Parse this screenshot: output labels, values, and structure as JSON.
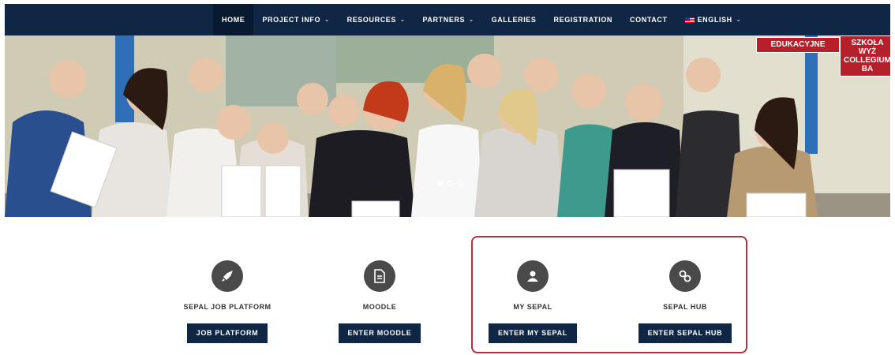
{
  "nav": {
    "items": [
      {
        "label": "HOME",
        "dropdown": false,
        "active": true
      },
      {
        "label": "PROJECT INFO",
        "dropdown": true
      },
      {
        "label": "RESOURCES",
        "dropdown": true
      },
      {
        "label": "PARTNERS",
        "dropdown": true
      },
      {
        "label": "GALLERIES",
        "dropdown": false
      },
      {
        "label": "REGISTRATION",
        "dropdown": false
      },
      {
        "label": "CONTACT",
        "dropdown": false
      },
      {
        "label": "ENGLISH",
        "dropdown": true,
        "icon": "uk-flag-icon"
      }
    ]
  },
  "hero": {
    "signs": [
      "EDUKACYJNE",
      "SZKOŁA WYŻ",
      "COLLEGIUM BA"
    ],
    "slider_dots": 3,
    "active_dot": 0
  },
  "features": [
    {
      "title": "SEPAL JOB PLATFORM",
      "button": "JOB PLATFORM",
      "icon": "rocket-icon"
    },
    {
      "title": "MOODLE",
      "button": "ENTER MOODLE",
      "icon": "document-icon"
    },
    {
      "title": "MY SEPAL",
      "button": "ENTER MY SEPAL",
      "icon": "user-icon"
    },
    {
      "title": "SEPAL HUB",
      "button": "ENTER SEPAL HUB",
      "icon": "link-icon"
    }
  ],
  "colors": {
    "nav_bg": "#0f2744",
    "button_bg": "#0f2744",
    "icon_circle": "#4a4a4a",
    "highlight_border": "#b0323c"
  }
}
